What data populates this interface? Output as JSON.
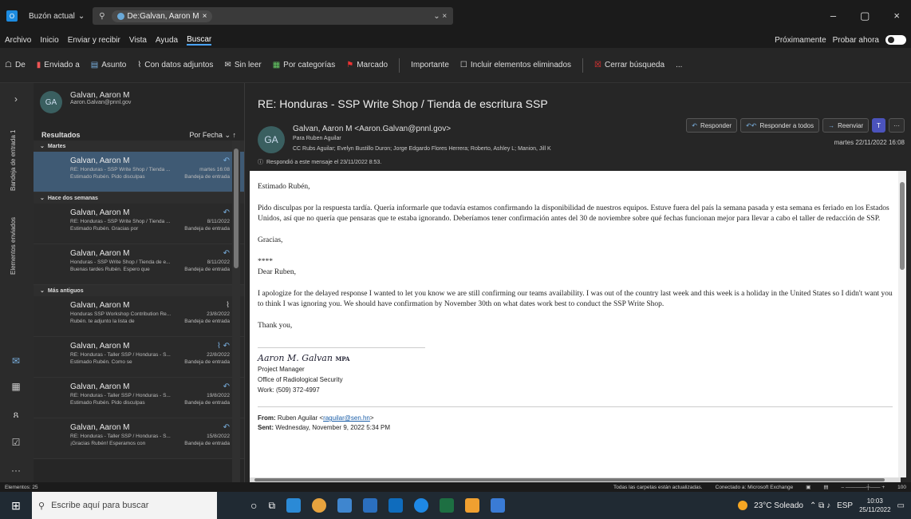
{
  "window": {
    "scope": "Buzón actual",
    "search_chip": "De:Galvan, Aaron M"
  },
  "menu": [
    "Archivo",
    "Inicio",
    "Enviar y recibir",
    "Vista",
    "Ayuda",
    "Buscar"
  ],
  "menu_right": {
    "coming": "Próximamente",
    "try": "Probar ahora"
  },
  "toolbar": [
    "De",
    "Enviado a",
    "Asunto",
    "Con datos adjuntos",
    "Sin leer",
    "Por categorías",
    "Marcado",
    "Importante",
    "Incluir elementos eliminados",
    "Cerrar búsqueda",
    "..."
  ],
  "rail": {
    "folder_label": "Bandeja de entrada 1",
    "items_label": "Elementos enviados"
  },
  "contact": {
    "name": "Galvan, Aaron M",
    "email": "Aaron.Galvan@pnnl.gov",
    "initials": "GA"
  },
  "results": {
    "label": "Resultados",
    "sort": "Por Fecha"
  },
  "groups": {
    "g1": "Martes",
    "g2": "Hace dos semanas",
    "g3": "Más antiguos"
  },
  "mails": [
    {
      "from": "Galvan, Aaron M",
      "subject": "RE: Honduras - SSP Write Shop / Tienda ...",
      "date": "martes 16:08",
      "preview": "Estimado Rubén. Pido disculpas",
      "folder": "Bandeja de entrada"
    },
    {
      "from": "Galvan, Aaron M",
      "subject": "RE: Honduras - SSP Write Shop / Tienda ...",
      "date": "8/11/2022",
      "preview": "Estimado Rubén. Gracias por",
      "folder": "Bandeja de entrada"
    },
    {
      "from": "Galvan, Aaron M",
      "subject": "Honduras - SSP Write Shop / Tienda de e...",
      "date": "8/11/2022",
      "preview": "Buenas tardes Rubén. Espero que",
      "folder": "Bandeja de entrada"
    },
    {
      "from": "Galvan, Aaron M",
      "subject": "Honduras SSP Workshop Contribution Re...",
      "date": "23/8/2022",
      "preview": "Rubén. te adjunto la lista de",
      "folder": "Bandeja de entrada"
    },
    {
      "from": "Galvan, Aaron M",
      "subject": "RE: Honduras - Taller SSP / Honduras - S...",
      "date": "22/8/2022",
      "preview": "Estimado Rubén. Como se",
      "folder": "Bandeja de entrada"
    },
    {
      "from": "Galvan, Aaron M",
      "subject": "RE: Honduras - Taller SSP / Honduras - S...",
      "date": "19/8/2022",
      "preview": "Estimado Rubén. Pido disculpas",
      "folder": "Bandeja de entrada"
    },
    {
      "from": "Galvan, Aaron M",
      "subject": "RE: Honduras - Taller SSP / Honduras - S...",
      "date": "15/8/2022",
      "preview": "¡Gracias Rubén! Esperamos con",
      "folder": "Bandeja de entrada"
    }
  ],
  "reading": {
    "subject": "RE: Honduras - SSP Write Shop / Tienda de escritura SSP",
    "sender": "Galvan, Aaron M <Aaron.Galvan@pnnl.gov>",
    "to": "Para  Ruben Aguilar",
    "cc": "CC  Rubs Aguilar; Evelyn Bustillo Duron; Jorge Edgardo Flores Herrera; Roberto, Ashley L; Manion, Jill K",
    "replied": "Respondió a este mensaje el 23/11/2022 8:53.",
    "date": "martes 22/11/2022 16:08",
    "btn_reply": "Responder",
    "btn_reply_all": "Responder a todos",
    "btn_forward": "Reenviar",
    "greeting_es": "Estimado Rubén,",
    "para_es": "Pido disculpas por la respuesta tardía. Quería informarle que todavía estamos confirmando la disponibilidad de nuestros equipos. Estuve fuera del país la semana pasada y esta semana es feriado en los Estados Unidos, así que no quería que pensaras que te estaba ignorando. Deberíamos tener confirmación antes del 30 de noviembre sobre qué fechas funcionan mejor para llevar a cabo el taller de redacción de SSP.",
    "thanks_es": "Gracias,",
    "stars": "****",
    "greeting_en": "Dear Ruben,",
    "para_en": "I apologize for the delayed response I wanted to let you know we are still confirming our teams availability. I was out of the country last week and this week is a holiday in the United States so I didn't want you to think I was ignoring you. We should have confirmation by November 30th on what dates work best to conduct the SSP Write Shop.",
    "thanks_en": "Thank you,",
    "sig_name": "Aaron M. Galvan",
    "sig_cred": "MPA",
    "sig_title": "Project Manager",
    "sig_office": "Office of Radiological Security",
    "sig_phone": "Work: (509) 372-4997",
    "from_label": "From:",
    "from_val": "Ruben Aguilar <",
    "from_email": "raguilar@sen.hn",
    "from_end": ">",
    "sent_label": "Sent:",
    "sent_val": "Wednesday, November 9, 2022 5:34 PM"
  },
  "status": {
    "items": "Elementos: 25",
    "sync": "Todas las carpetas están actualizadas.",
    "conn": "Conectado a: Microsoft Exchange",
    "zoom": "100"
  },
  "taskbar": {
    "search": "Escribe aquí para buscar",
    "weather": "23°C  Soleado",
    "lang": "ESP",
    "time": "10:03",
    "date": "25/11/2022"
  }
}
